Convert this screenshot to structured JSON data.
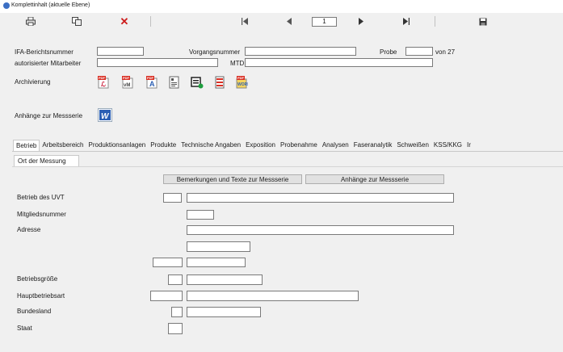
{
  "window": {
    "title": "Komplettinhalt (aktuelle Ebene)"
  },
  "toolbar": {
    "print_icon": "printer-icon",
    "copy_icon": "copy-icon",
    "delete_icon": "delete-icon",
    "first_icon": "first-record-icon",
    "prev_icon": "previous-record-icon",
    "record_value": "1",
    "next_icon": "next-record-icon",
    "last_icon": "last-record-icon",
    "save_icon": "save-icon"
  },
  "header": {
    "ifa_label": "IFA-Berichtsnummer",
    "ifa_value": "",
    "vorgang_label": "Vorgangsnummer",
    "vorgang_value": "",
    "probe_label": "Probe",
    "probe_value": "",
    "von_label": "von 27",
    "mitarbeiter_label": "autorisierter Mitarbeiter",
    "mitarbeiter_value": "",
    "mtd_label": "MTD",
    "mtd_value": "",
    "archiv_label": "Archivierung",
    "anhaenge_label": "Anhänge zur Messserie",
    "pdf_badge": "PDF"
  },
  "tabs": [
    "Betrieb",
    "Arbeitsbereich",
    "Produktionsanlagen",
    "Produkte",
    "Technische Angaben",
    "Exposition",
    "Probenahme",
    "Analysen",
    "Faseranalytik",
    "Schweißen",
    "KSS/KKG",
    "Ir"
  ],
  "active_tab": "Betrieb",
  "subtab": "Ort der Messung",
  "buttons": {
    "bemerkungen": "Bemerkungen und Texte zur Messserie",
    "anhaenge": "Anhänge zur Messserie"
  },
  "fields": {
    "betrieb_label": "Betrieb des UVT",
    "mitglied_label": "Mitgliedsnummer",
    "adresse_label": "Adresse",
    "groesse_label": "Betriebsgröße",
    "hauptbetrieb_label": "Hauptbetriebsart",
    "bundesland_label": "Bundesland",
    "staat_label": "Staat"
  },
  "colors": {
    "pdf_red": "#d93025",
    "word_blue": "#2b5fb4",
    "window_bg": "#f0f0f0"
  }
}
